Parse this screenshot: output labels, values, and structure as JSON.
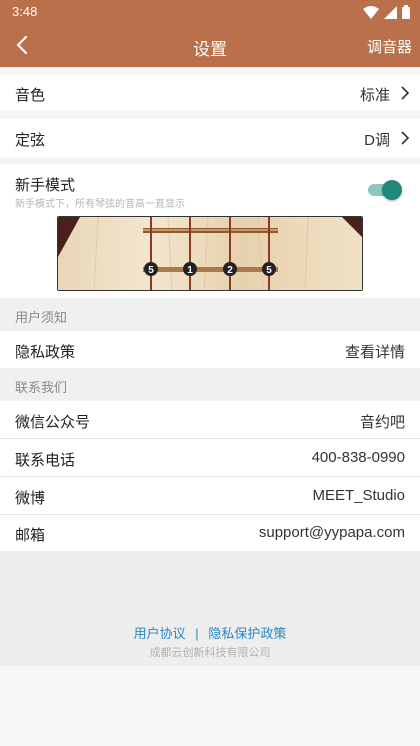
{
  "status_bar": {
    "time": "3:48"
  },
  "header": {
    "title": "设置",
    "right_action": "调音器"
  },
  "settings": {
    "tone": {
      "label": "音色",
      "value": "标准"
    },
    "tuning": {
      "label": "定弦",
      "value": "D调"
    },
    "beginner": {
      "label": "新手模式",
      "description": "新手模式下，所有琴弦的音高一直显示",
      "enabled": true
    }
  },
  "fretboard_notes": [
    "5",
    "1",
    "2",
    "5"
  ],
  "user_notice": {
    "header": "用户须知",
    "privacy": {
      "label": "隐私政策",
      "value": "查看详情"
    }
  },
  "contact": {
    "header": "联系我们",
    "wechat": {
      "label": "微信公众号",
      "value": "音约吧"
    },
    "phone": {
      "label": "联系电话",
      "value": "400-838-0990"
    },
    "weibo": {
      "label": "微博",
      "value": "MEET_Studio"
    },
    "email": {
      "label": "邮箱",
      "value": "support@yypapa.com"
    }
  },
  "footer": {
    "user_agreement": "用户协议",
    "separator": "|",
    "privacy_policy": "隐私保护政策",
    "company": "成都云创新科技有限公司"
  },
  "colors": {
    "brand": "#b9704b",
    "toggle": "#1f8a7a",
    "link": "#2b86c2"
  }
}
